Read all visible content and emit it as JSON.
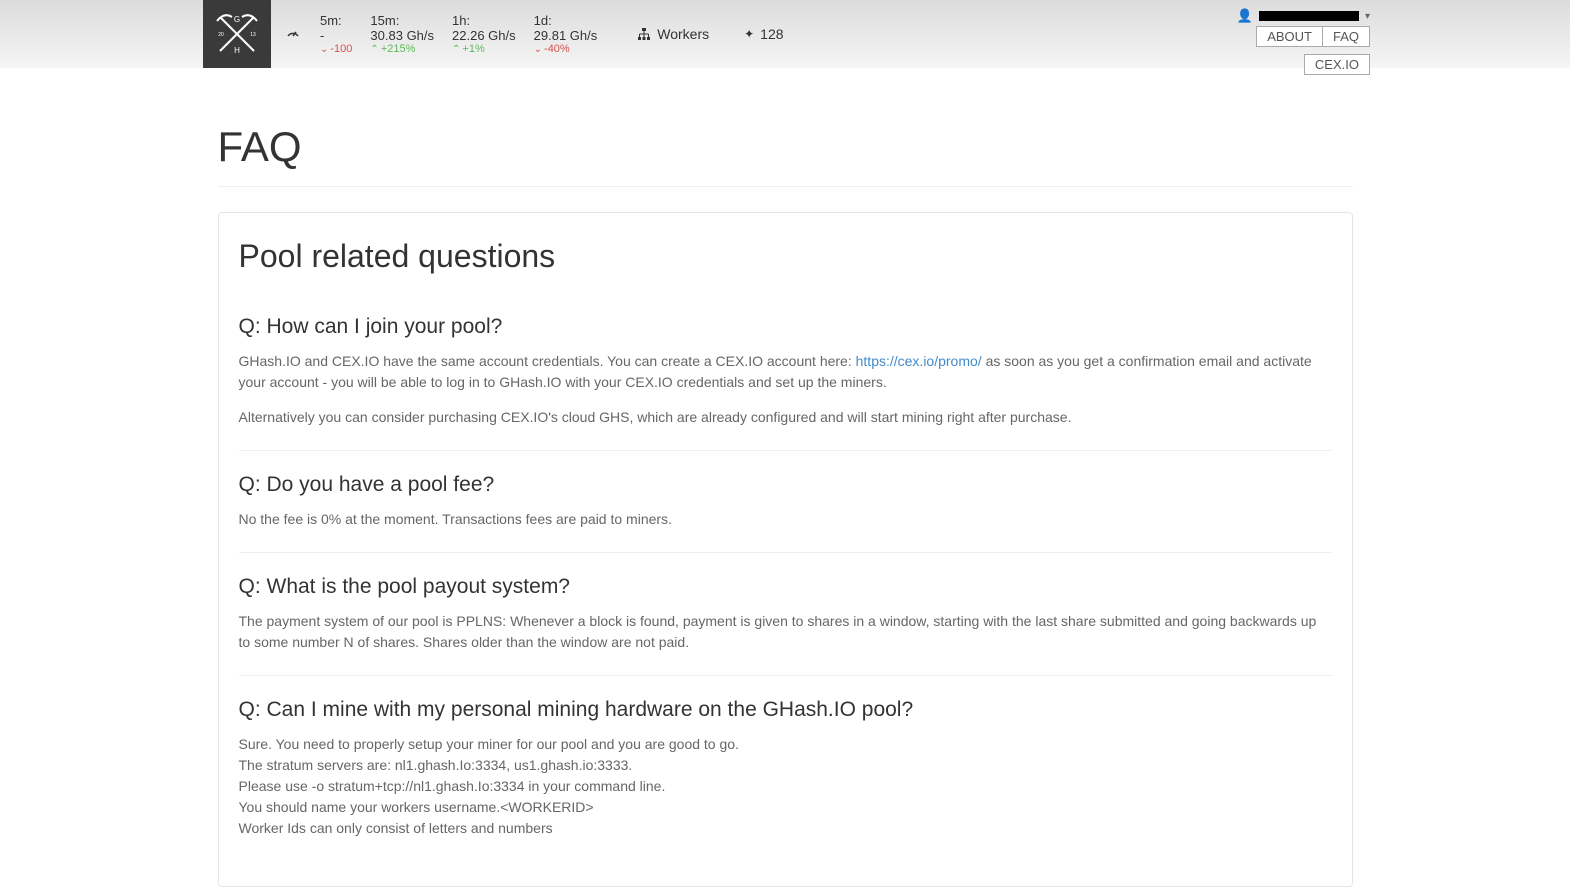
{
  "header": {
    "stats": [
      {
        "label": "5m:",
        "value": "-",
        "trendArrow": "down",
        "trendVal": "-100"
      },
      {
        "label": "15m:",
        "value": "30.83 Gh/s",
        "trendArrow": "up",
        "trendVal": "+215%"
      },
      {
        "label": "1h:",
        "value": "22.26 Gh/s",
        "trendArrow": "up",
        "trendVal": "+1%"
      },
      {
        "label": "1d:",
        "value": "29.81 Gh/s",
        "trendArrow": "down",
        "trendVal": "-40%"
      }
    ],
    "workersLabel": "Workers",
    "countValue": "128"
  },
  "nav": {
    "about": "ABOUT",
    "faq": "FAQ",
    "cex": "CEX.IO"
  },
  "page": {
    "title": "FAQ",
    "sectionTitle": "Pool related questions",
    "faqs": [
      {
        "q": "Q: How can I join your pool?",
        "a1_pre": "GHash.IO and CEX.IO have the same account credentials. You can create a CEX.IO account here: ",
        "a1_link": "https://cex.io/promo/",
        "a1_post": " as soon as you get a confirmation email and activate your account - you will be able to log in to GHash.IO with your CEX.IO credentials and set up the miners.",
        "a2": "Alternatively you can consider purchasing CEX.IO's cloud GHS, which are already configured and will start mining right after purchase."
      },
      {
        "q": "Q: Do you have a pool fee?",
        "a1": "No the fee is 0% at the moment. Transactions fees are paid to miners."
      },
      {
        "q": "Q: What is the pool payout system?",
        "a1": "The payment system of our pool is PPLNS: Whenever a block is found, payment is given to shares in a window, starting with the last share submitted and going backwards up to some number N of shares. Shares older than the window are not paid."
      },
      {
        "q": "Q: Can I mine with my personal mining hardware on the GHash.IO pool?",
        "lines": [
          "Sure. You need to properly setup your miner for our pool and you are good to go.",
          "The stratum servers are: nl1.ghash.Io:3334, us1.ghash.io:3333.",
          "Please use -o stratum+tcp://nl1.ghash.Io:3334 in your command line.",
          "You should name your workers username.<WORKERID>",
          "Worker Ids can only consist of letters and numbers"
        ]
      }
    ]
  }
}
